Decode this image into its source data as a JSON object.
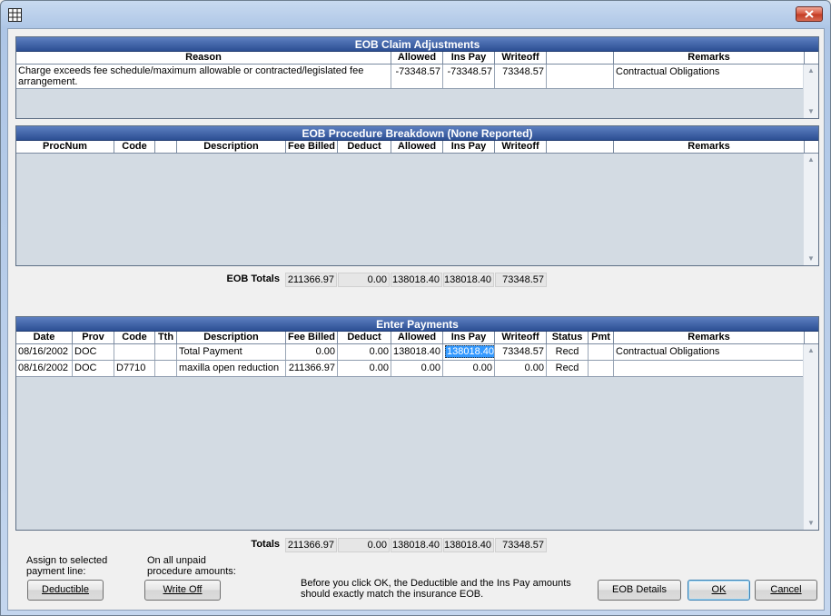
{
  "colors": {
    "title_bar": "#2c4f93",
    "selection": "#3399ff",
    "grid_empty": "#d3dbe3"
  },
  "window": {
    "icon": "grid-icon",
    "close_icon": "close-icon"
  },
  "claim_adjustments": {
    "title": "EOB Claim Adjustments",
    "columns": [
      "Reason",
      "Allowed",
      "Ins Pay",
      "Writeoff",
      "",
      "Remarks"
    ],
    "rows": [
      {
        "reason": "Charge exceeds fee schedule/maximum allowable or contracted/legislated fee arrangement.",
        "allowed": "-73348.57",
        "ins_pay": "-73348.57",
        "writeoff": "73348.57",
        "extra": "",
        "remarks": "Contractual Obligations"
      }
    ]
  },
  "procedure_breakdown": {
    "title": "EOB Procedure Breakdown (None Reported)",
    "columns": [
      "ProcNum",
      "Code",
      "",
      "Description",
      "Fee Billed",
      "Deduct",
      "Allowed",
      "Ins Pay",
      "Writeoff",
      "",
      "Remarks"
    ]
  },
  "eob_totals": {
    "label": "EOB Totals",
    "values": [
      "211366.97",
      "0.00",
      "138018.40",
      "138018.40",
      "73348.57"
    ]
  },
  "enter_payments": {
    "title": "Enter Payments",
    "columns": [
      "Date",
      "Prov",
      "Code",
      "Tth",
      "Description",
      "Fee Billed",
      "Deduct",
      "Allowed",
      "Ins Pay",
      "Writeoff",
      "Status",
      "Pmt",
      "Remarks"
    ],
    "rows": [
      {
        "date": "08/16/2002",
        "prov": "DOC",
        "code": "",
        "tth": "",
        "description": "Total Payment",
        "fee_billed": "0.00",
        "deduct": "0.00",
        "allowed": "138018.40",
        "ins_pay": "138018.40",
        "writeoff": "73348.57",
        "status": "Recd",
        "pmt": "",
        "remarks": "Contractual Obligations"
      },
      {
        "date": "08/16/2002",
        "prov": "DOC",
        "code": "D7710",
        "tth": "",
        "description": "maxilla open reduction",
        "fee_billed": "211366.97",
        "deduct": "0.00",
        "allowed": "0.00",
        "ins_pay": "0.00",
        "writeoff": "0.00",
        "status": "Recd",
        "pmt": "",
        "remarks": ""
      }
    ]
  },
  "totals": {
    "label": "Totals",
    "values": [
      "211366.97",
      "0.00",
      "138018.40",
      "138018.40",
      "73348.57"
    ]
  },
  "footer": {
    "assign_note": "Assign to selected payment line:",
    "deductible_label": "Deductible",
    "unpaid_note": "On all unpaid procedure amounts:",
    "writeoff_label": "Write Off",
    "warning": "Before you click OK, the Deductible and the Ins Pay amounts should exactly match the insurance EOB.",
    "eob_details_label": "EOB Details",
    "ok_label": "OK",
    "cancel_label": "Cancel"
  }
}
